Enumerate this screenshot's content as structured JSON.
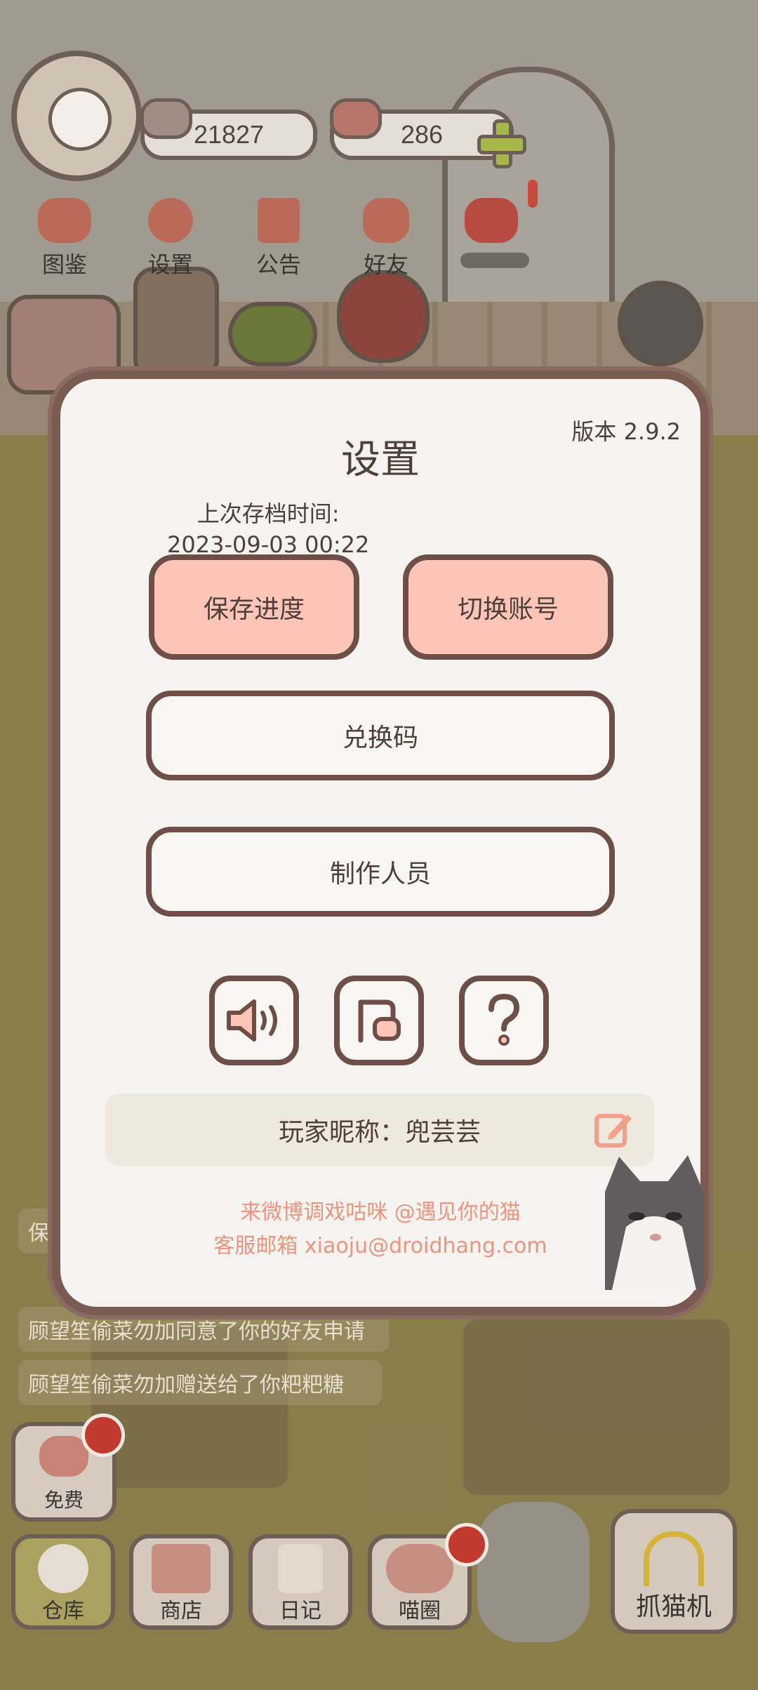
{
  "hud": {
    "fish_count": "21827",
    "heart_count": "286",
    "nav": [
      {
        "label": "图鉴",
        "icon": "cat-book-icon"
      },
      {
        "label": "设置",
        "icon": "gear-icon"
      },
      {
        "label": "公告",
        "icon": "gift-icon"
      },
      {
        "label": "好友",
        "icon": "friends-icon"
      }
    ]
  },
  "settings": {
    "title": "设置",
    "version": "版本 2.9.2",
    "last_save_label": "上次存档时间:",
    "last_save_time": "2023-09-03 00:22",
    "save_button": "保存进度",
    "switch_button": "切换账号",
    "redeem_button": "兑换码",
    "credits_button": "制作人员",
    "nickname": "玩家昵称：兜芸芸",
    "weibo_text": "来微博调戏咕咪 @遇见你的猫",
    "email_text": "客服邮箱 xiaoju@droidhang.com"
  },
  "chat": [
    "保",
    "顾望笙偷菜勿加同意了你的好友申请",
    "顾望笙偷菜勿加赠送给了你粑粑糖"
  ],
  "bottom": {
    "free_label": "免费",
    "nav": [
      {
        "label": "仓库",
        "icon": "warehouse-icon"
      },
      {
        "label": "商店",
        "icon": "shop-icon"
      },
      {
        "label": "日记",
        "icon": "diary-icon"
      },
      {
        "label": "喵圈",
        "icon": "cat-planet-icon"
      }
    ],
    "claw_label": "抓猫机"
  },
  "colors": {
    "accent_pink": "#fdc4b8",
    "modal_border": "#7b5a52",
    "link": "#ea9580",
    "badge_red": "#c23a2f"
  }
}
